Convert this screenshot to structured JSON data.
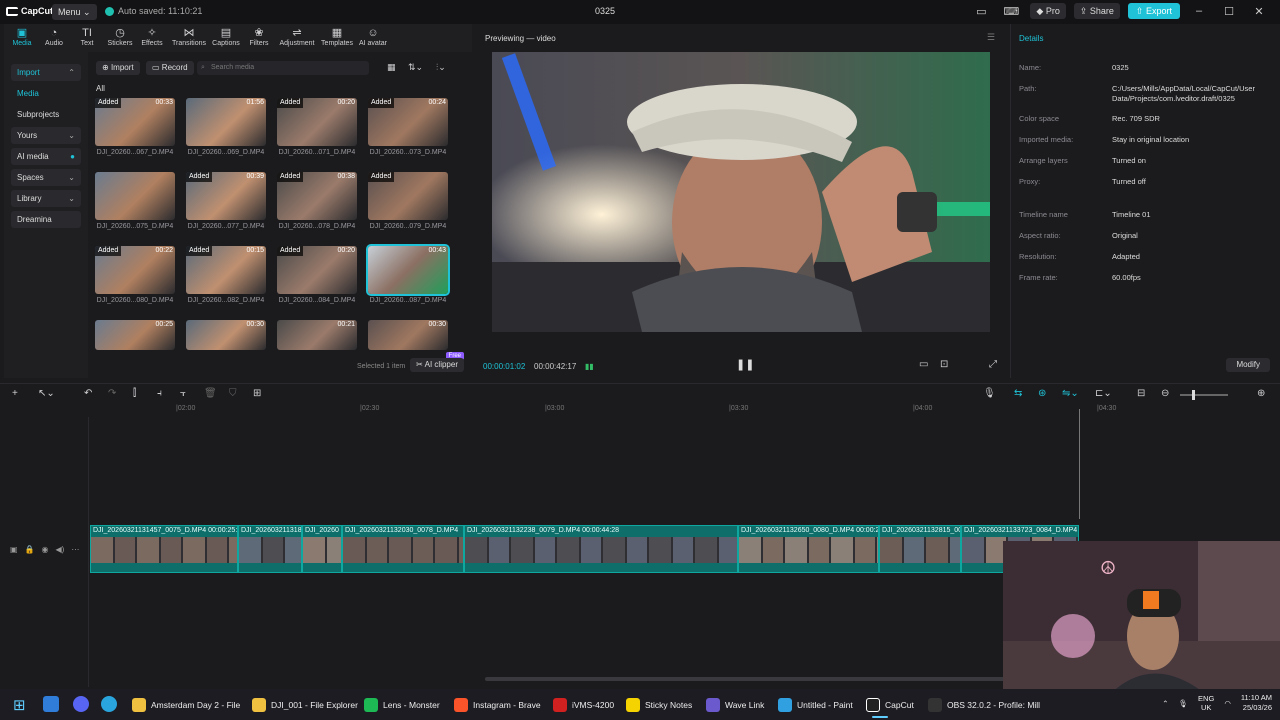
{
  "titlebar": {
    "app_name": "CapCut",
    "menu_label": "Menu",
    "autosave": "Auto saved: 11:10:21",
    "project_title": "0325",
    "pro_label": "Pro",
    "share_label": "Share",
    "export_label": "Export"
  },
  "tools": [
    "Media",
    "Audio",
    "Text",
    "Stickers",
    "Effects",
    "Transitions",
    "Captions",
    "Filters",
    "Adjustment",
    "Templates",
    "AI avatar"
  ],
  "leftnav": {
    "import": "Import",
    "media": "Media",
    "subprojects": "Subprojects",
    "yours": "Yours",
    "ai_media": "AI media",
    "spaces": "Spaces",
    "library": "Library",
    "dreamina": "Dreamina"
  },
  "library": {
    "import_btn": "Import",
    "record_btn": "Record",
    "search_placeholder": "Search media",
    "all_label": "All",
    "selected_text": "Selected 1 item",
    "ai_clipper": "AI clipper",
    "free_tag": "Free",
    "added": "Added",
    "clips": [
      {
        "label": "DJI_20260...067_D.MP4",
        "dur": "00:33",
        "added": true
      },
      {
        "label": "DJI_20260...069_D.MP4",
        "dur": "01:56",
        "added": false
      },
      {
        "label": "DJI_20260...071_D.MP4",
        "dur": "00:20",
        "added": true
      },
      {
        "label": "DJI_20260...073_D.MP4",
        "dur": "00:24",
        "added": true
      },
      {
        "label": "DJI_20260...075_D.MP4",
        "dur": "",
        "added": false
      },
      {
        "label": "DJI_20260...077_D.MP4",
        "dur": "00:39",
        "added": true
      },
      {
        "label": "DJI_20260...078_D.MP4",
        "dur": "00:38",
        "added": true
      },
      {
        "label": "DJI_20260...079_D.MP4",
        "dur": "",
        "added": true
      },
      {
        "label": "DJI_20260...080_D.MP4",
        "dur": "00:22",
        "added": true
      },
      {
        "label": "DJI_20260...082_D.MP4",
        "dur": "00:15",
        "added": true
      },
      {
        "label": "DJI_20260...084_D.MP4",
        "dur": "00:20",
        "added": true
      },
      {
        "label": "DJI_20260...087_D.MP4",
        "dur": "00:43",
        "added": false
      },
      {
        "label": "",
        "dur": "00:25",
        "added": false
      },
      {
        "label": "",
        "dur": "00:30",
        "added": false
      },
      {
        "label": "",
        "dur": "00:21",
        "added": false
      },
      {
        "label": "",
        "dur": "00:30",
        "added": false
      }
    ]
  },
  "preview": {
    "title": "Previewing — video",
    "current_time": "00:00:01:02",
    "total_time": "00:00:42:17"
  },
  "details": {
    "title": "Details",
    "rows": [
      {
        "label": "Name:",
        "value": "0325"
      },
      {
        "label": "Path:",
        "value": "C:/Users/Mills/AppData/Local/CapCut/User Data/Projects/com.lveditor.draft/0325"
      },
      {
        "label": "Color space",
        "value": "Rec. 709 SDR"
      },
      {
        "label": "Imported media:",
        "value": "Stay in original location"
      },
      {
        "label": "Arrange layers",
        "value": "Turned on"
      },
      {
        "label": "Proxy:",
        "value": "Turned off"
      },
      {
        "label": "Timeline name",
        "value": "Timeline 01"
      },
      {
        "label": "Aspect ratio:",
        "value": "Original"
      },
      {
        "label": "Resolution:",
        "value": "Adapted"
      },
      {
        "label": "Frame rate:",
        "value": "60.00fps"
      }
    ],
    "modify": "Modify"
  },
  "timeline": {
    "ruler": [
      "|02:00",
      "|02:30",
      "|03:00",
      "|03:30",
      "|04:00",
      "|04:30"
    ],
    "clips": [
      {
        "title": "DJI_20260321131457_0075_D.MP4   00:00:25:25"
      },
      {
        "title": "DJI_20260321131821"
      },
      {
        "title": "DJI_20260"
      },
      {
        "title": "DJI_20260321132030_0078_D.MP4"
      },
      {
        "title": "DJI_20260321132238_0079_D.MP4   00:00:44:28"
      },
      {
        "title": "DJI_20260321132650_0080_D.MP4   00:00:2"
      },
      {
        "title": "DJI_20260321132815_008"
      },
      {
        "title": "DJI_20260321133723_0084_D.MP4"
      }
    ]
  },
  "taskbar": {
    "items": [
      "Amsterdam Day 2 - File",
      "DJI_001 - File Explorer",
      "Lens - Monster",
      "Instagram - Brave",
      "iVMS-4200",
      "Sticky Notes",
      "Wave Link",
      "Untitled - Paint",
      "CapCut",
      "OBS 32.0.2 - Profile: Mill"
    ],
    "lang": "ENG",
    "region": "UK",
    "time": "11:10 AM",
    "date": "25/03/26"
  },
  "colors": {
    "accent": "#1fc2d6",
    "clip_teal": "#0e6e6a"
  }
}
